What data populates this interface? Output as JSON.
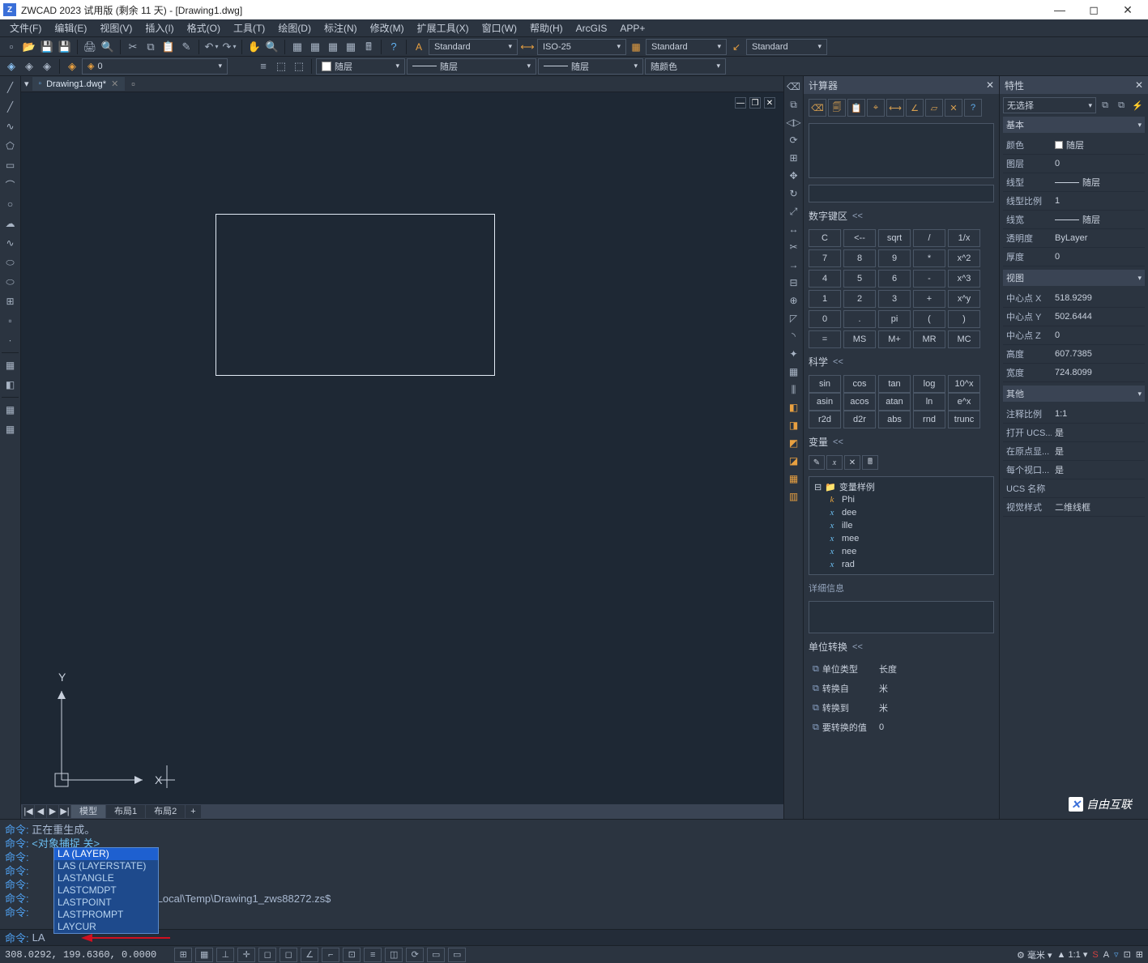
{
  "window": {
    "title": "ZWCAD 2023 试用版 (剩余 11 天) - [Drawing1.dwg]",
    "min": "—",
    "max": "◻",
    "close": "✕"
  },
  "menu": {
    "items": [
      "文件(F)",
      "编辑(E)",
      "视图(V)",
      "插入(I)",
      "格式(O)",
      "工具(T)",
      "绘图(D)",
      "标注(N)",
      "修改(M)",
      "扩展工具(X)",
      "窗口(W)",
      "帮助(H)",
      "ArcGIS",
      "APP+"
    ]
  },
  "toolbar1": {
    "style_dd1": "Standard",
    "style_dd2": "ISO-25",
    "style_dd3": "Standard",
    "style_dd4": "Standard"
  },
  "toolbar2": {
    "layer_color": "随层",
    "linetype": "随层",
    "lineweight": "随层",
    "color_bylayer": "随颜色"
  },
  "doc_tab": {
    "name": "Drawing1.dwg*"
  },
  "model_tabs": {
    "items": [
      "模型",
      "布局1",
      "布局2"
    ],
    "active": 0
  },
  "ucs": {
    "x": "X",
    "y": "Y"
  },
  "calc": {
    "title": "计算器",
    "sections": {
      "numpad": "数字键区",
      "sci": "科学",
      "var": "变量",
      "units": "单位转换"
    },
    "numpad_keys": [
      [
        "C",
        "<--",
        "sqrt",
        "/",
        "1/x"
      ],
      [
        "7",
        "8",
        "9",
        "*",
        "x^2"
      ],
      [
        "4",
        "5",
        "6",
        "-",
        "x^3"
      ],
      [
        "1",
        "2",
        "3",
        "+",
        "x^y"
      ],
      [
        "0",
        ".",
        "pi",
        "(",
        ")"
      ],
      [
        "=",
        "MS",
        "M+",
        "MR",
        "MC"
      ]
    ],
    "sci_rows": [
      [
        "sin",
        "cos",
        "tan",
        "log",
        "10^x"
      ],
      [
        "asin",
        "acos",
        "atan",
        "ln",
        "e^x"
      ],
      [
        "r2d",
        "d2r",
        "abs",
        "rnd",
        "trunc"
      ]
    ],
    "var_root": "变量样例",
    "vars": [
      "Phi",
      "dee",
      "ille",
      "mee",
      "nee",
      "rad"
    ],
    "detail_label": "详细信息",
    "units": {
      "type_label": "单位类型",
      "type_val": "长度",
      "from_label": "转换自",
      "from_val": "米",
      "to_label": "转换到",
      "to_val": "米",
      "value_label": "要转换的值",
      "value_val": "0"
    }
  },
  "props": {
    "title": "特性",
    "selector": "无选择",
    "sections": {
      "basic": "基本",
      "view": "视图",
      "other": "其他"
    },
    "basic": {
      "color_k": "颜色",
      "color_v": "随层",
      "layer_k": "图层",
      "layer_v": "0",
      "linetype_k": "线型",
      "linetype_v": "随层",
      "ltscale_k": "线型比例",
      "ltscale_v": "1",
      "lw_k": "线宽",
      "lw_v": "随层",
      "trans_k": "透明度",
      "trans_v": "ByLayer",
      "thick_k": "厚度",
      "thick_v": "0"
    },
    "view": {
      "cx_k": "中心点 X",
      "cx_v": "518.9299",
      "cy_k": "中心点 Y",
      "cy_v": "502.6444",
      "cz_k": "中心点 Z",
      "cz_v": "0",
      "h_k": "高度",
      "h_v": "607.7385",
      "w_k": "宽度",
      "w_v": "724.8099"
    },
    "other": {
      "anno_k": "注释比例",
      "anno_v": "1:1",
      "openucs_k": "打开 UCS...",
      "openucs_v": "是",
      "orig_k": "在原点显...",
      "orig_v": "是",
      "pervp_k": "每个视口...",
      "pervp_v": "是",
      "ucsname_k": "UCS 名称",
      "ucsname_v": "",
      "vstyle_k": "视觉样式",
      "vstyle_v": "二维线框"
    }
  },
  "cmd": {
    "prefix": "命令: ",
    "lines": {
      "l1": "正在重生成。",
      "l2": "<对象捕捉 关>",
      "l3_path": "ta\\Local\\Temp\\Drawing1_zws88272.zs$"
    },
    "current_input": "LA",
    "autocomplete": [
      "LA (LAYER)",
      "LAS (LAYERSTATE)",
      "LASTANGLE",
      "LASTCMDPT",
      "LASTPOINT",
      "LASTPROMPT",
      "LAYCUR"
    ]
  },
  "status": {
    "coords": "308.0292, 199.6360, 0.0000",
    "right_unit": "毫米",
    "right_scale": "1:1"
  },
  "watermark": "自由互联"
}
